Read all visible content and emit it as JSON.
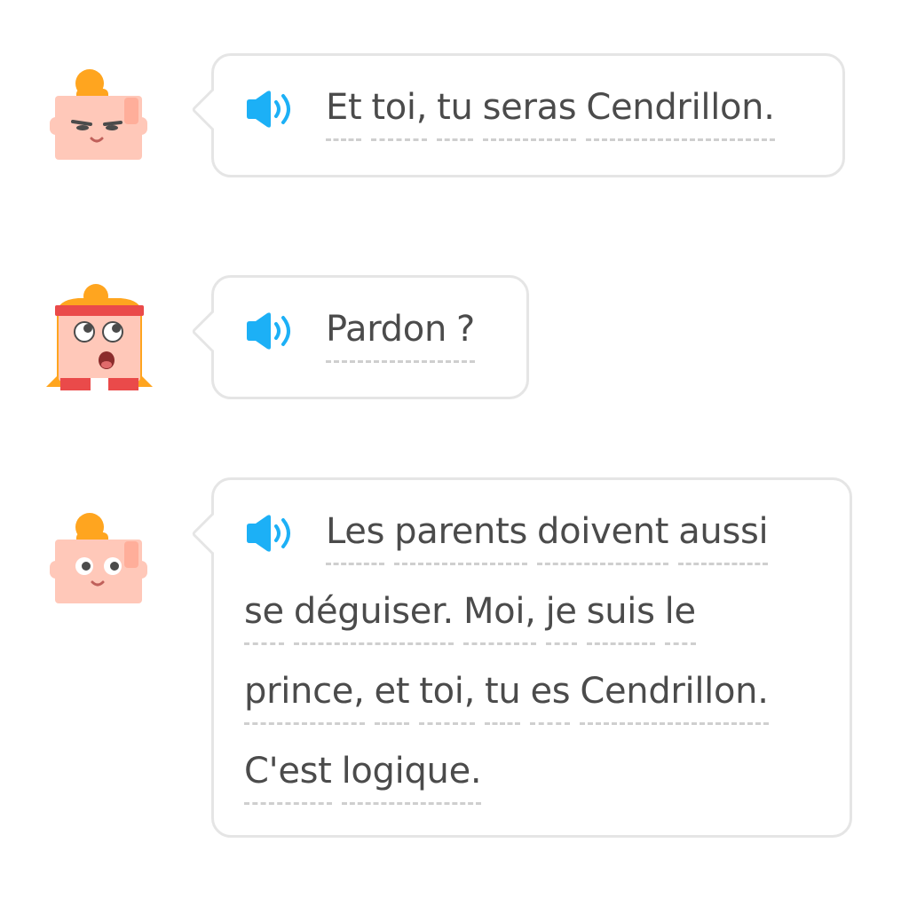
{
  "messages": [
    {
      "speaker": "man-glasses",
      "audio_icon": "speaker-icon",
      "lines": [
        [
          "Et",
          "toi,",
          "tu",
          "seras",
          "Cendrillon."
        ]
      ]
    },
    {
      "speaker": "girl-headband",
      "audio_icon": "speaker-icon",
      "lines": [
        [
          "Pardon",
          "?"
        ]
      ]
    },
    {
      "speaker": "man",
      "audio_icon": "speaker-icon",
      "lines": [
        [
          "Les",
          "parents",
          "doivent",
          "aussi"
        ],
        [
          "se",
          "déguiser.",
          "Moi,",
          "je",
          "suis",
          "le"
        ],
        [
          "prince,",
          "et",
          "toi,",
          "tu",
          "es",
          "Cendrillon."
        ],
        [
          "C'est",
          "logique."
        ]
      ]
    }
  ],
  "colors": {
    "speaker_blue": "#1cb0f6",
    "bubble_border": "#e5e5e5",
    "text": "#4b4b4b",
    "hair": "#ffa51f",
    "skin": "#ffc8b9",
    "headband": "#ea4a4a"
  }
}
